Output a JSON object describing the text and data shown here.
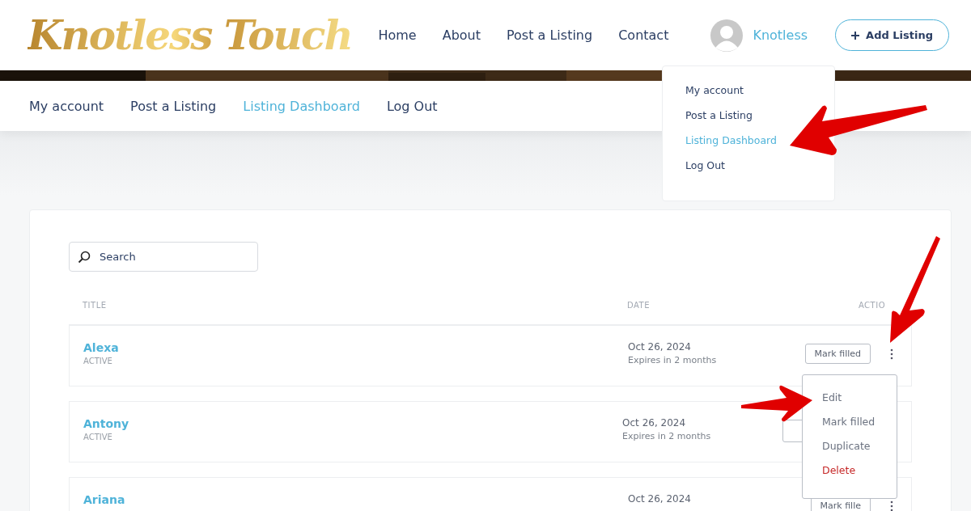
{
  "header": {
    "logo": "Knotless Touch",
    "nav": [
      {
        "label": "Home"
      },
      {
        "label": "About"
      },
      {
        "label": "Post a Listing"
      },
      {
        "label": "Contact"
      }
    ],
    "user": "Knotless",
    "add_button": "Add Listing"
  },
  "account_nav": [
    {
      "label": "My account",
      "selected": false
    },
    {
      "label": "Post a Listing",
      "selected": false
    },
    {
      "label": "Listing Dashboard",
      "selected": true
    },
    {
      "label": "Log Out",
      "selected": false
    }
  ],
  "user_menu": [
    {
      "label": "My account",
      "selected": false
    },
    {
      "label": "Post a Listing",
      "selected": false
    },
    {
      "label": "Listing Dashboard",
      "selected": true
    },
    {
      "label": "Log Out",
      "selected": false
    }
  ],
  "search": {
    "placeholder": "Search"
  },
  "table": {
    "columns": [
      "TITLE",
      "DATE",
      "ACTIO"
    ],
    "rows": [
      {
        "title": "Alexa",
        "status": "ACTIVE",
        "date": "Oct 26, 2024",
        "expires": "Expires in 2 months",
        "action": "Mark filled"
      },
      {
        "title": "Antony",
        "status": "ACTIVE",
        "date": "Oct 26, 2024",
        "expires": "Expires in 2 months"
      },
      {
        "title": "Ariana",
        "date": "Oct 26, 2024",
        "action": "Mark fille"
      }
    ]
  },
  "action_menu": [
    {
      "label": "Edit",
      "kind": "normal"
    },
    {
      "label": "Mark filled",
      "kind": "normal"
    },
    {
      "label": "Duplicate",
      "kind": "normal"
    },
    {
      "label": "Delete",
      "kind": "danger"
    }
  ]
}
